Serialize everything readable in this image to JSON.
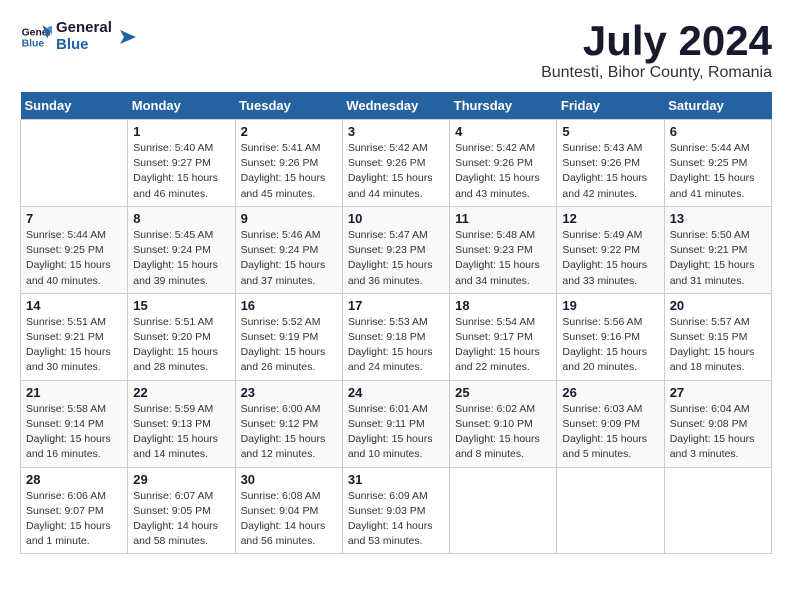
{
  "header": {
    "logo_line1": "General",
    "logo_line2": "Blue",
    "title": "July 2024",
    "subtitle": "Buntesti, Bihor County, Romania"
  },
  "calendar": {
    "days_of_week": [
      "Sunday",
      "Monday",
      "Tuesday",
      "Wednesday",
      "Thursday",
      "Friday",
      "Saturday"
    ],
    "weeks": [
      [
        {
          "day": "",
          "content": ""
        },
        {
          "day": "1",
          "content": "Sunrise: 5:40 AM\nSunset: 9:27 PM\nDaylight: 15 hours\nand 46 minutes."
        },
        {
          "day": "2",
          "content": "Sunrise: 5:41 AM\nSunset: 9:26 PM\nDaylight: 15 hours\nand 45 minutes."
        },
        {
          "day": "3",
          "content": "Sunrise: 5:42 AM\nSunset: 9:26 PM\nDaylight: 15 hours\nand 44 minutes."
        },
        {
          "day": "4",
          "content": "Sunrise: 5:42 AM\nSunset: 9:26 PM\nDaylight: 15 hours\nand 43 minutes."
        },
        {
          "day": "5",
          "content": "Sunrise: 5:43 AM\nSunset: 9:26 PM\nDaylight: 15 hours\nand 42 minutes."
        },
        {
          "day": "6",
          "content": "Sunrise: 5:44 AM\nSunset: 9:25 PM\nDaylight: 15 hours\nand 41 minutes."
        }
      ],
      [
        {
          "day": "7",
          "content": "Sunrise: 5:44 AM\nSunset: 9:25 PM\nDaylight: 15 hours\nand 40 minutes."
        },
        {
          "day": "8",
          "content": "Sunrise: 5:45 AM\nSunset: 9:24 PM\nDaylight: 15 hours\nand 39 minutes."
        },
        {
          "day": "9",
          "content": "Sunrise: 5:46 AM\nSunset: 9:24 PM\nDaylight: 15 hours\nand 37 minutes."
        },
        {
          "day": "10",
          "content": "Sunrise: 5:47 AM\nSunset: 9:23 PM\nDaylight: 15 hours\nand 36 minutes."
        },
        {
          "day": "11",
          "content": "Sunrise: 5:48 AM\nSunset: 9:23 PM\nDaylight: 15 hours\nand 34 minutes."
        },
        {
          "day": "12",
          "content": "Sunrise: 5:49 AM\nSunset: 9:22 PM\nDaylight: 15 hours\nand 33 minutes."
        },
        {
          "day": "13",
          "content": "Sunrise: 5:50 AM\nSunset: 9:21 PM\nDaylight: 15 hours\nand 31 minutes."
        }
      ],
      [
        {
          "day": "14",
          "content": "Sunrise: 5:51 AM\nSunset: 9:21 PM\nDaylight: 15 hours\nand 30 minutes."
        },
        {
          "day": "15",
          "content": "Sunrise: 5:51 AM\nSunset: 9:20 PM\nDaylight: 15 hours\nand 28 minutes."
        },
        {
          "day": "16",
          "content": "Sunrise: 5:52 AM\nSunset: 9:19 PM\nDaylight: 15 hours\nand 26 minutes."
        },
        {
          "day": "17",
          "content": "Sunrise: 5:53 AM\nSunset: 9:18 PM\nDaylight: 15 hours\nand 24 minutes."
        },
        {
          "day": "18",
          "content": "Sunrise: 5:54 AM\nSunset: 9:17 PM\nDaylight: 15 hours\nand 22 minutes."
        },
        {
          "day": "19",
          "content": "Sunrise: 5:56 AM\nSunset: 9:16 PM\nDaylight: 15 hours\nand 20 minutes."
        },
        {
          "day": "20",
          "content": "Sunrise: 5:57 AM\nSunset: 9:15 PM\nDaylight: 15 hours\nand 18 minutes."
        }
      ],
      [
        {
          "day": "21",
          "content": "Sunrise: 5:58 AM\nSunset: 9:14 PM\nDaylight: 15 hours\nand 16 minutes."
        },
        {
          "day": "22",
          "content": "Sunrise: 5:59 AM\nSunset: 9:13 PM\nDaylight: 15 hours\nand 14 minutes."
        },
        {
          "day": "23",
          "content": "Sunrise: 6:00 AM\nSunset: 9:12 PM\nDaylight: 15 hours\nand 12 minutes."
        },
        {
          "day": "24",
          "content": "Sunrise: 6:01 AM\nSunset: 9:11 PM\nDaylight: 15 hours\nand 10 minutes."
        },
        {
          "day": "25",
          "content": "Sunrise: 6:02 AM\nSunset: 9:10 PM\nDaylight: 15 hours\nand 8 minutes."
        },
        {
          "day": "26",
          "content": "Sunrise: 6:03 AM\nSunset: 9:09 PM\nDaylight: 15 hours\nand 5 minutes."
        },
        {
          "day": "27",
          "content": "Sunrise: 6:04 AM\nSunset: 9:08 PM\nDaylight: 15 hours\nand 3 minutes."
        }
      ],
      [
        {
          "day": "28",
          "content": "Sunrise: 6:06 AM\nSunset: 9:07 PM\nDaylight: 15 hours\nand 1 minute."
        },
        {
          "day": "29",
          "content": "Sunrise: 6:07 AM\nSunset: 9:05 PM\nDaylight: 14 hours\nand 58 minutes."
        },
        {
          "day": "30",
          "content": "Sunrise: 6:08 AM\nSunset: 9:04 PM\nDaylight: 14 hours\nand 56 minutes."
        },
        {
          "day": "31",
          "content": "Sunrise: 6:09 AM\nSunset: 9:03 PM\nDaylight: 14 hours\nand 53 minutes."
        },
        {
          "day": "",
          "content": ""
        },
        {
          "day": "",
          "content": ""
        },
        {
          "day": "",
          "content": ""
        }
      ]
    ]
  }
}
